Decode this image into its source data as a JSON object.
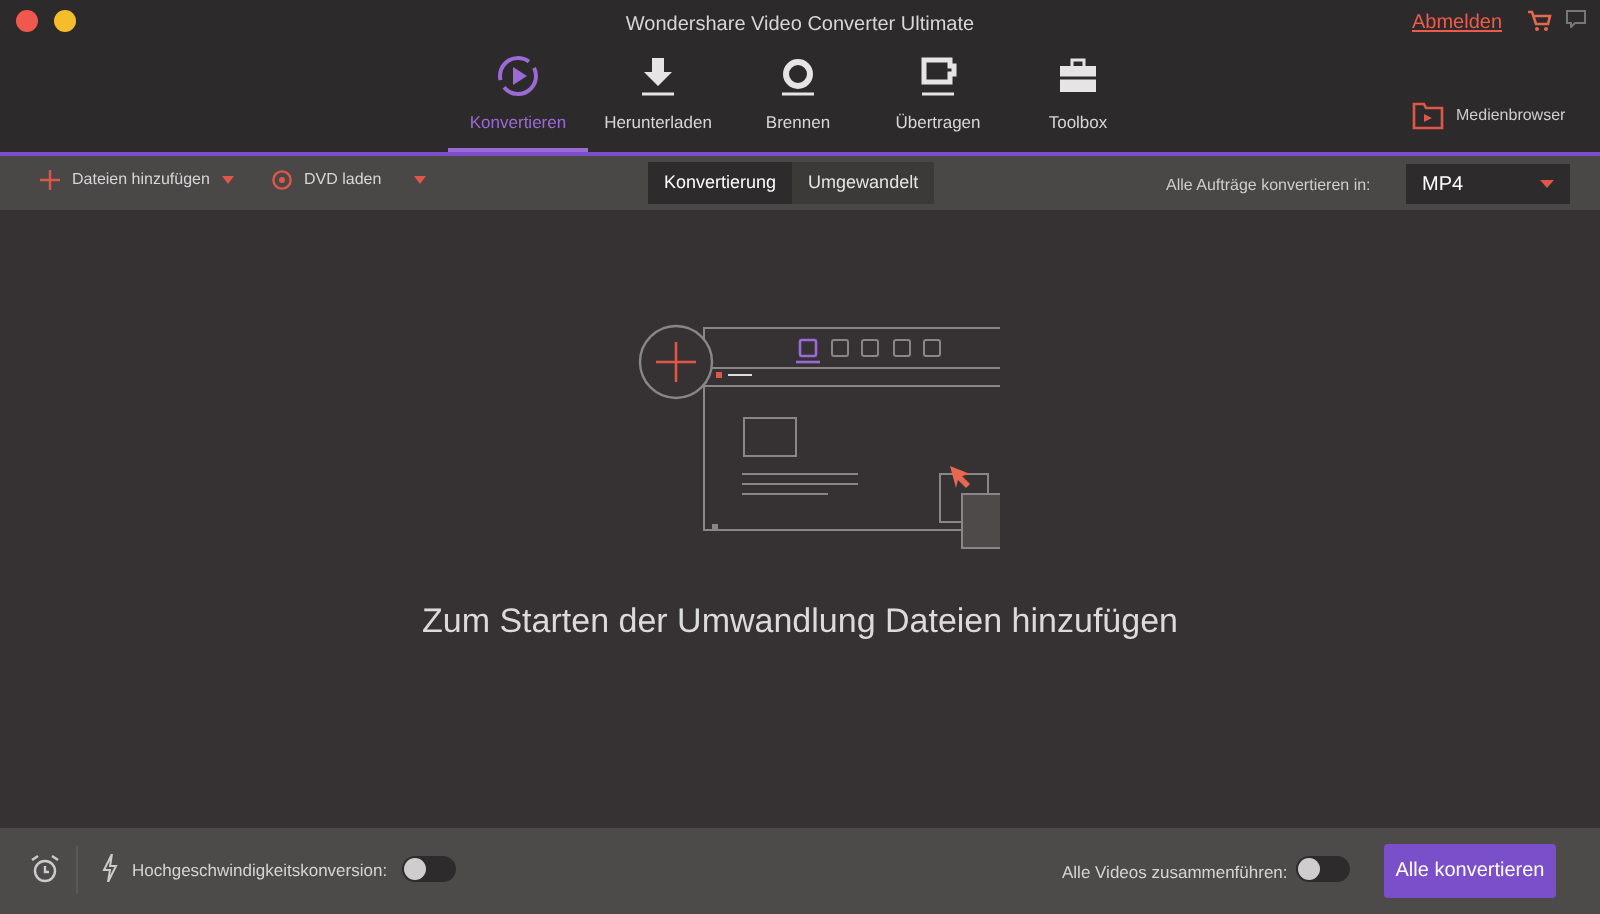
{
  "window": {
    "title": "Wondershare Video Converter Ultimate",
    "logout": "Abmelden"
  },
  "nav": [
    {
      "label": "Konvertieren",
      "selected": true,
      "kind": "convert"
    },
    {
      "label": "Herunterladen",
      "selected": false,
      "kind": "download"
    },
    {
      "label": "Brennen",
      "selected": false,
      "kind": "burn"
    },
    {
      "label": "Übertragen",
      "selected": false,
      "kind": "transfer"
    },
    {
      "label": "Toolbox",
      "selected": false,
      "kind": "toolbox"
    }
  ],
  "media_browser": "Medienbrowser",
  "toolbar": {
    "add_files": "Dateien hinzufügen",
    "dvd": "DVD laden",
    "subtabs": [
      {
        "label": "Konvertierung",
        "selected": true
      },
      {
        "label": "Umgewandelt",
        "selected": false
      }
    ],
    "convert_all_label": "Alle Aufträge konvertieren in:",
    "format": "MP4"
  },
  "empty_message": "Zum Starten der Umwandlung Dateien hinzufügen",
  "bottom": {
    "speed_label": "Hochgeschwindigkeitskonversion:",
    "speed_on": false,
    "merge_label": "Alle Videos zusammenführen:",
    "merge_on": false,
    "convert_button": "Alle konvertieren"
  }
}
